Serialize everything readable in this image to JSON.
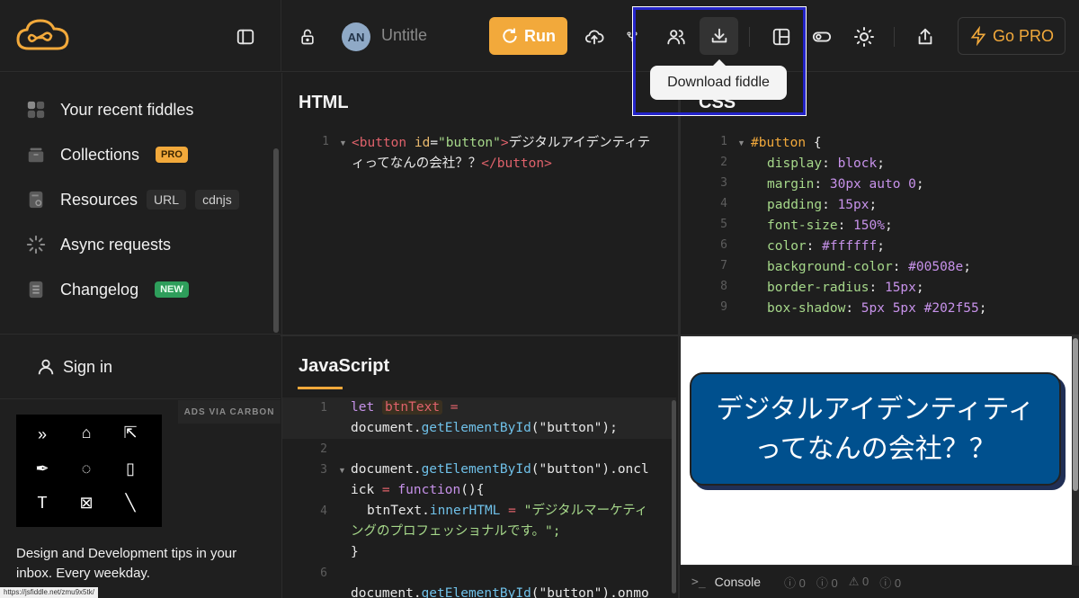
{
  "header": {
    "fiddle_title": "Untitle",
    "avatar_initials": "AN",
    "run_label": "Run",
    "gopro_label": "Go PRO",
    "tooltip": "Download fiddle"
  },
  "sidebar": {
    "items": [
      {
        "label": "Your recent fiddles",
        "icon": "grid-icon"
      },
      {
        "label": "Collections",
        "icon": "box-icon",
        "badge": "PRO"
      },
      {
        "label": "Resources",
        "icon": "file-icon",
        "tags": [
          "URL",
          "cdnjs"
        ]
      },
      {
        "label": "Async requests",
        "icon": "spinner-icon"
      },
      {
        "label": "Changelog",
        "icon": "doc-icon",
        "badge": "NEW"
      }
    ],
    "signin_label": "Sign in",
    "ads_label": "ADS VIA CARBON",
    "ad_text": "Design and Development tips in your inbox. Every weekday.",
    "status_url": "https://jsfiddle.net/zmu9x5tk/"
  },
  "panels": {
    "html_title": "HTML",
    "css_title": "CSS",
    "js_title": "JavaScript"
  },
  "html_code": {
    "tag_open": "<button",
    "attr": "id",
    "eq": "=",
    "attr_val": "\"button\"",
    "gt": ">",
    "text1": "デジタルアイデンティテ",
    "text2": "ィってなんの会社？？",
    "tag_close": "</button",
    "gt2": ">"
  },
  "css_code": [
    {
      "n": "1",
      "sel": "#button",
      "rest": " {"
    },
    {
      "n": "2",
      "prop": "display",
      "val": "block"
    },
    {
      "n": "3",
      "prop": "margin",
      "val": "30px auto 0"
    },
    {
      "n": "4",
      "prop": "padding",
      "val": "15px"
    },
    {
      "n": "5",
      "prop": "font-size",
      "val": "150%"
    },
    {
      "n": "6",
      "prop": "color",
      "val": "#ffffff"
    },
    {
      "n": "7",
      "prop": "background-color",
      "val": "#00508e"
    },
    {
      "n": "8",
      "prop": "border-radius",
      "val": "15px"
    },
    {
      "n": "9",
      "prop": "box-shadow",
      "val": "5px 5px #202f55"
    }
  ],
  "js_code": {
    "l1_kw": "let",
    "l1_var": "btnText",
    "l1_eq": " =",
    "l1b_obj": "document.",
    "l1b_fn": "getElementById",
    "l1b_arg": "(\"button\");",
    "l3_obj": "document.",
    "l3_fn": "getElementById",
    "l3_arg": "(\"button\").",
    "l3_ev": "oncl",
    "l3b_ev": "ick",
    "l3b_eq": " = ",
    "l3b_kw": "function",
    "l3b_rest": "(){",
    "l4_obj": "btnText.",
    "l4_prop": "innerHTML",
    "l4_eq": " = ",
    "l4_str1": "\"デジタルマーケティ",
    "l4_str2": "ングのプロフェッショナルです。\";",
    "l5": "}",
    "l7_obj": "document.",
    "l7_fn": "getElementById",
    "l7_arg": "(\"button\").",
    "l7_ev": "onmo"
  },
  "preview": {
    "button_line1": "デジタルアイデンティティ",
    "button_line2": "ってなんの会社？？"
  },
  "console": {
    "label": "Console",
    "counts": [
      "0",
      "0",
      "0",
      "0"
    ]
  },
  "colors": {
    "accent": "#f2a93b",
    "preview_button_bg": "#00508e",
    "preview_button_shadow": "#202f55",
    "highlight_box": "#2323c8"
  }
}
